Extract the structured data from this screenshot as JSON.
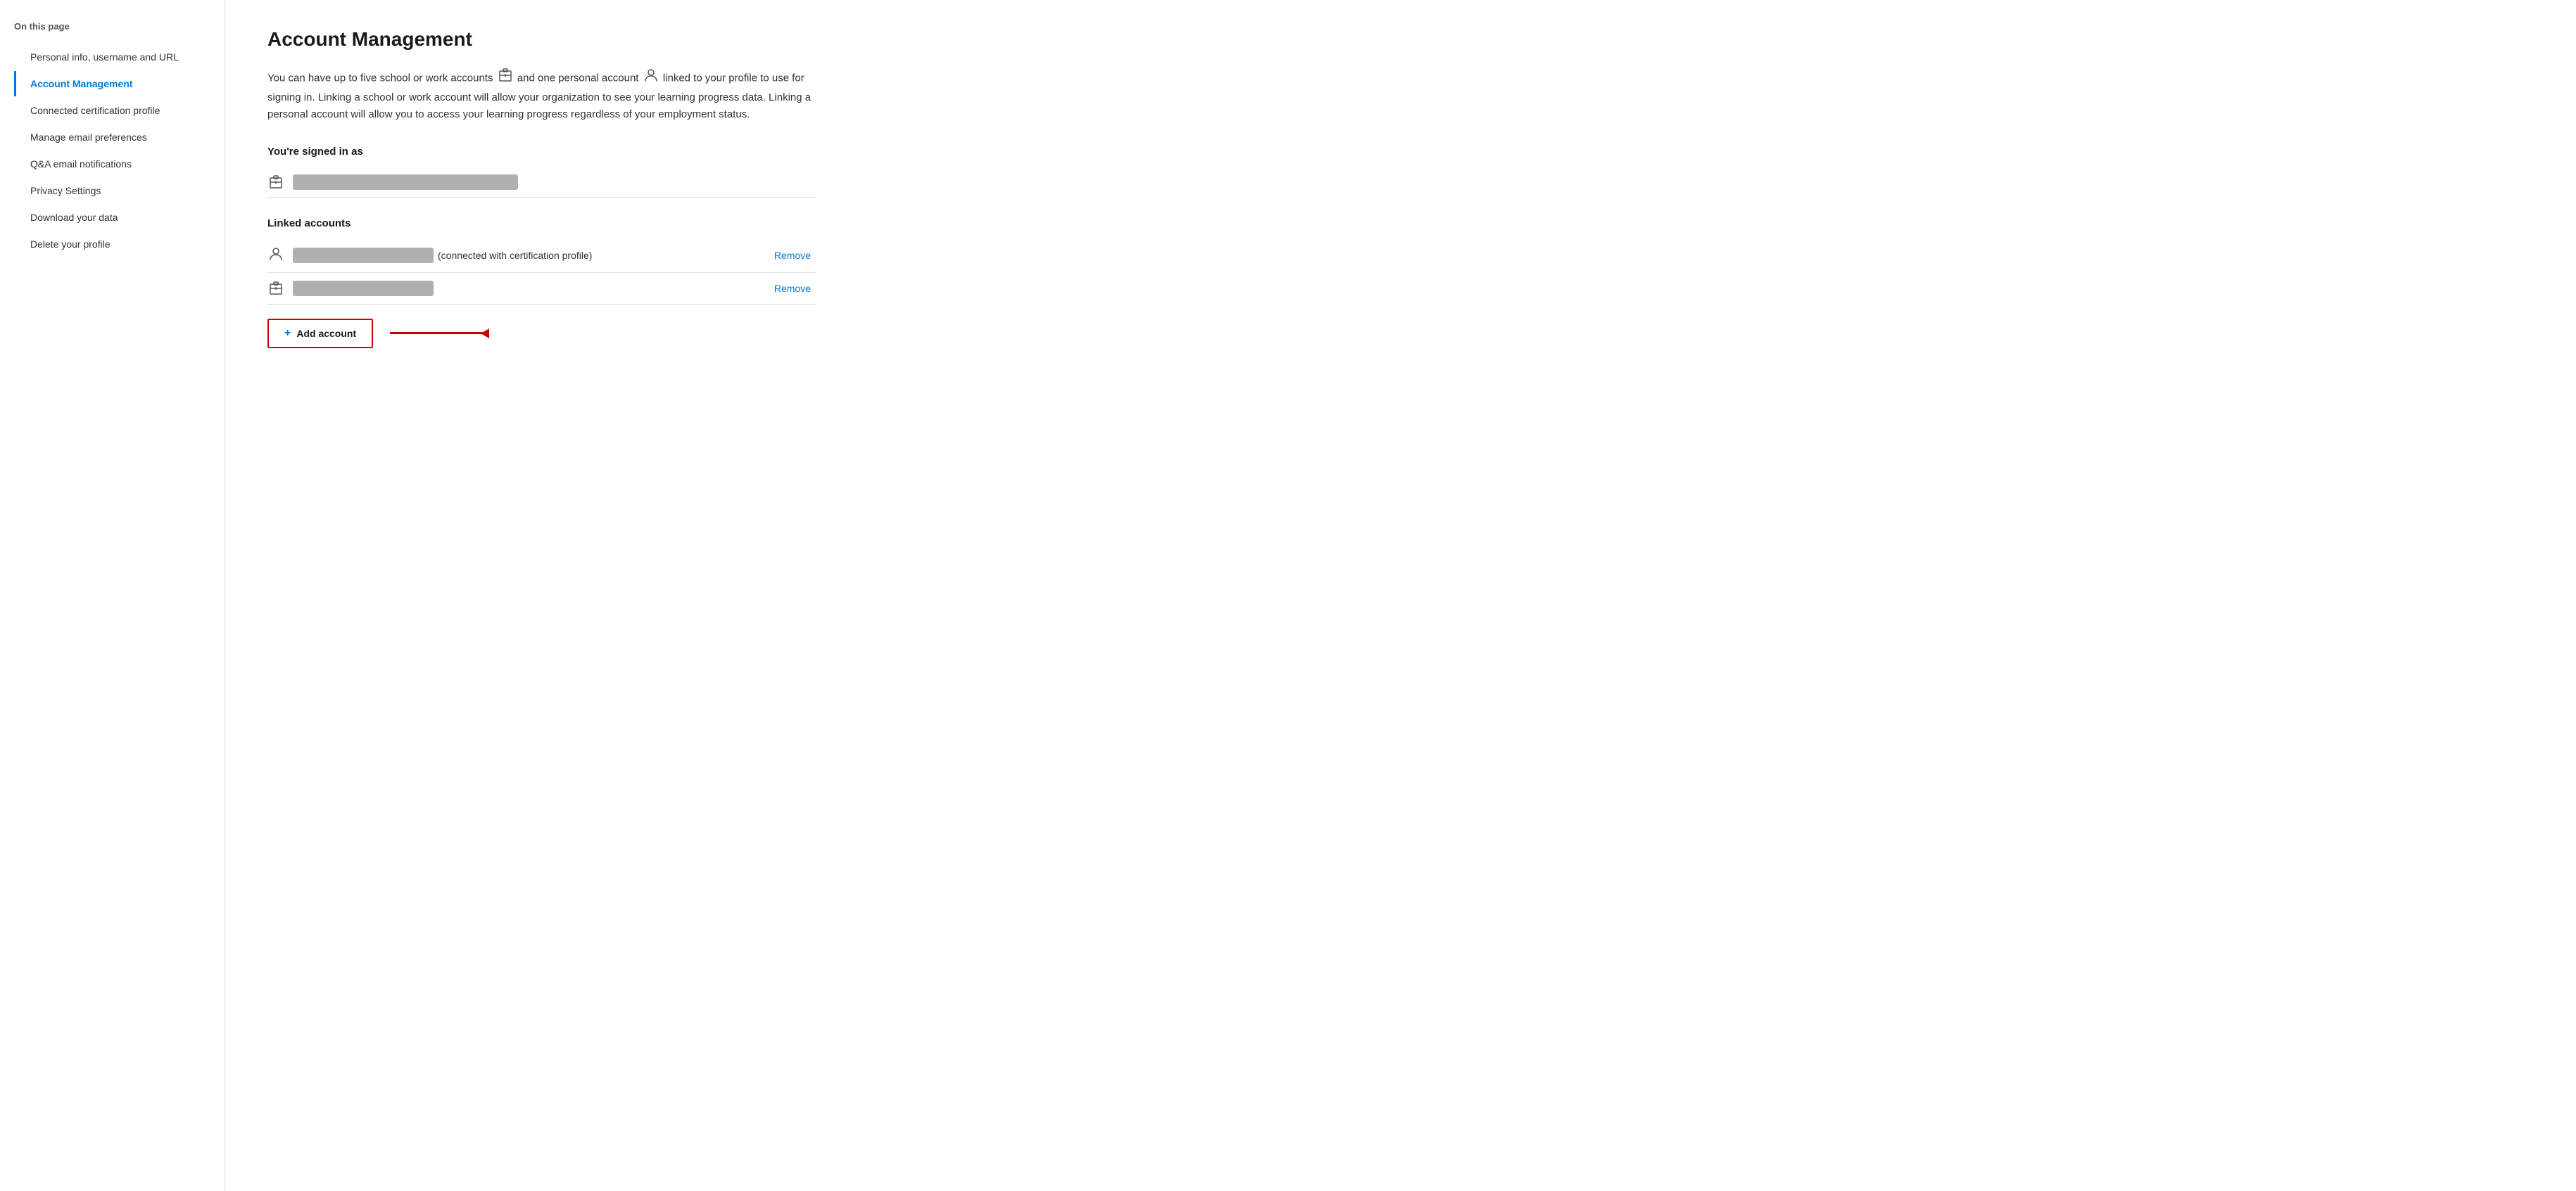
{
  "sidebar": {
    "on_this_page": "On this page",
    "items": [
      {
        "id": "personal-info",
        "label": "Personal info, username and URL",
        "active": false
      },
      {
        "id": "account-management",
        "label": "Account Management",
        "active": true
      },
      {
        "id": "certification-profile",
        "label": "Connected certification profile",
        "active": false
      },
      {
        "id": "email-preferences",
        "label": "Manage email preferences",
        "active": false
      },
      {
        "id": "qa-notifications",
        "label": "Q&A email notifications",
        "active": false
      },
      {
        "id": "privacy-settings",
        "label": "Privacy Settings",
        "active": false
      },
      {
        "id": "download-data",
        "label": "Download your data",
        "active": false
      },
      {
        "id": "delete-profile",
        "label": "Delete your profile",
        "active": false
      }
    ]
  },
  "main": {
    "title": "Account Management",
    "description_part1": "You can have up to five school or work accounts",
    "description_part2": "and one personal account",
    "description_part3": "linked to your profile to use for signing in. Linking a school or work account will allow your organization to see your learning progress data. Linking a personal account will allow you to access your learning progress regardless of your employment status.",
    "signed_in_label": "You're signed in as",
    "linked_accounts_label": "Linked accounts",
    "linked_account1_suffix": "(connected with certification profile)",
    "remove_label": "Remove",
    "add_account_label": "Add account",
    "plus_icon": "+"
  },
  "colors": {
    "accent_blue": "#0078d4",
    "red_border": "#d00000",
    "placeholder_gray": "#b0b0b0"
  }
}
